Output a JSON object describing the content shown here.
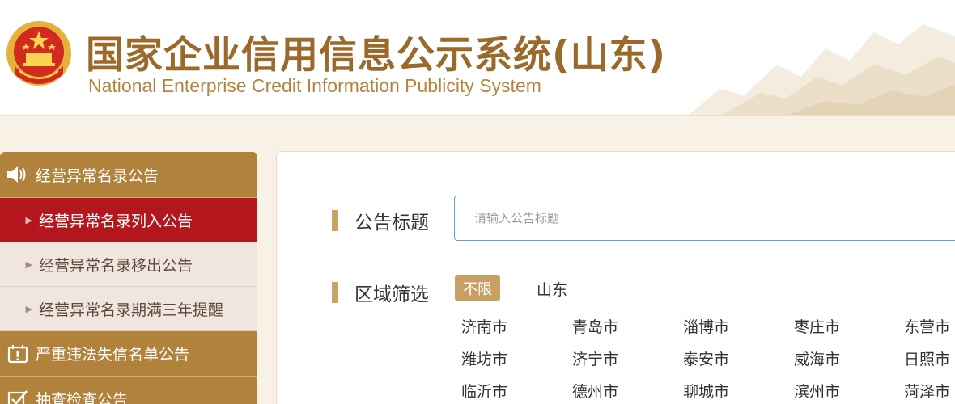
{
  "header": {
    "title_cn": "国家企业信用信息公示系统(山东)",
    "title_en": "National Enterprise Credit Information Publicity System"
  },
  "sidebar": {
    "categories": [
      {
        "label": "经营异常名录公告",
        "icon": "speaker-icon",
        "items": [
          {
            "label": "经营异常名录列入公告",
            "active": true
          },
          {
            "label": "经营异常名录移出公告",
            "active": false
          },
          {
            "label": "经营异常名录期满三年提醒",
            "active": false
          }
        ]
      },
      {
        "label": "严重违法失信名单公告",
        "icon": "notice-board-icon",
        "items": []
      },
      {
        "label": "抽查检查公告",
        "icon": "checkbox-icon",
        "items": []
      }
    ]
  },
  "main": {
    "title_label": "公告标题",
    "title_placeholder": "请输入公告标题",
    "region_label": "区域筛选",
    "region_all": "不限",
    "province": "山东",
    "cities": [
      [
        "济南市",
        "青岛市",
        "淄博市",
        "枣庄市",
        "东营市"
      ],
      [
        "潍坊市",
        "济宁市",
        "泰安市",
        "威海市",
        "日照市"
      ],
      [
        "临沂市",
        "德州市",
        "聊城市",
        "滨州市",
        "菏泽市"
      ]
    ]
  },
  "colors": {
    "accent_gold": "#b0823b",
    "active_red": "#b3171d",
    "title_brown": "#9b6a2b"
  }
}
